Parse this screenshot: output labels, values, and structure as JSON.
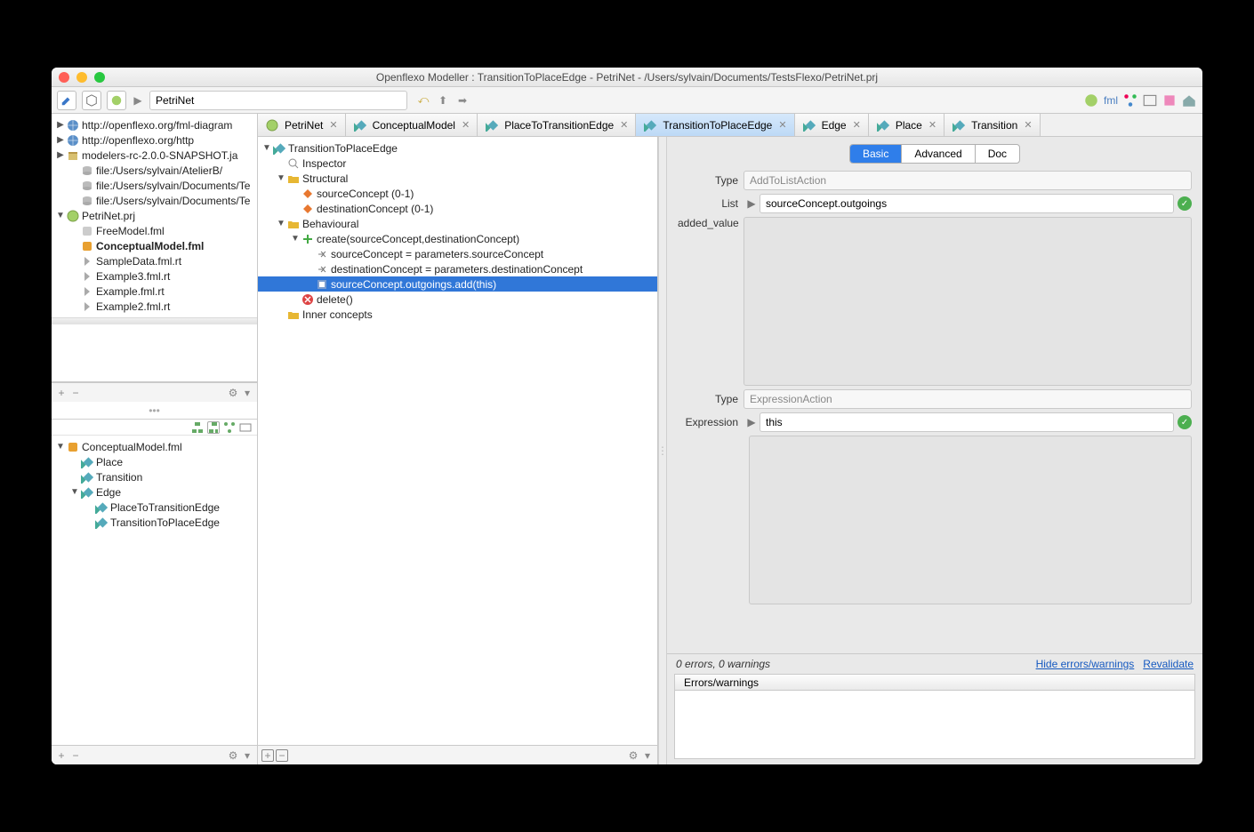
{
  "window": {
    "title": "Openflexo Modeller : TransitionToPlaceEdge - PetriNet - /Users/sylvain/Documents/TestsFlexo/PetriNet.prj"
  },
  "breadcrumb": {
    "current": "PetriNet"
  },
  "navTree": [
    {
      "indent": 0,
      "tog": "▶",
      "icon": "world",
      "label": "http://openflexo.org/fml-diagram",
      "bold": false
    },
    {
      "indent": 0,
      "tog": "▶",
      "icon": "world",
      "label": "http://openflexo.org/http",
      "bold": false
    },
    {
      "indent": 0,
      "tog": "▶",
      "icon": "archive",
      "label": "modelers-rc-2.0.0-SNAPSHOT.ja",
      "bold": false
    },
    {
      "indent": 1,
      "tog": "",
      "icon": "db",
      "label": "file:/Users/sylvain/AtelierB/",
      "bold": false
    },
    {
      "indent": 1,
      "tog": "",
      "icon": "db",
      "label": "file:/Users/sylvain/Documents/Te",
      "bold": false
    },
    {
      "indent": 1,
      "tog": "",
      "icon": "db",
      "label": "file:/Users/sylvain/Documents/Te",
      "bold": false
    },
    {
      "indent": 0,
      "tog": "▼",
      "icon": "proj",
      "label": "PetriNet.prj",
      "bold": false
    },
    {
      "indent": 1,
      "tog": "",
      "icon": "fml-g",
      "label": "FreeModel.fml",
      "bold": false
    },
    {
      "indent": 1,
      "tog": "",
      "icon": "fml",
      "label": "ConceptualModel.fml",
      "bold": true
    },
    {
      "indent": 1,
      "tog": "",
      "icon": "rt",
      "label": "SampleData.fml.rt",
      "bold": false
    },
    {
      "indent": 1,
      "tog": "",
      "icon": "rt",
      "label": "Example3.fml.rt",
      "bold": false
    },
    {
      "indent": 1,
      "tog": "",
      "icon": "rt",
      "label": "Example.fml.rt",
      "bold": false
    },
    {
      "indent": 1,
      "tog": "",
      "icon": "rt",
      "label": "Example2.fml.rt",
      "bold": false
    }
  ],
  "browserTree": [
    {
      "indent": 0,
      "tog": "▼",
      "icon": "fml",
      "label": "ConceptualModel.fml"
    },
    {
      "indent": 1,
      "tog": "",
      "icon": "cube",
      "label": "Place"
    },
    {
      "indent": 1,
      "tog": "",
      "icon": "cube",
      "label": "Transition"
    },
    {
      "indent": 1,
      "tog": "▼",
      "icon": "cube",
      "label": "Edge"
    },
    {
      "indent": 2,
      "tog": "",
      "icon": "cube",
      "label": "PlaceToTransitionEdge"
    },
    {
      "indent": 2,
      "tog": "",
      "icon": "cube",
      "label": "TransitionToPlaceEdge"
    }
  ],
  "tabs": [
    {
      "label": "PetriNet",
      "icon": "proj",
      "active": false
    },
    {
      "label": "ConceptualModel",
      "icon": "cube",
      "active": false
    },
    {
      "label": "PlaceToTransitionEdge",
      "icon": "cube",
      "active": false
    },
    {
      "label": "TransitionToPlaceEdge",
      "icon": "cube",
      "active": true
    },
    {
      "label": "Edge",
      "icon": "cube",
      "active": false
    },
    {
      "label": "Place",
      "icon": "cube",
      "active": false
    },
    {
      "label": "Transition",
      "icon": "cube",
      "active": false
    }
  ],
  "centerTree": [
    {
      "indent": 0,
      "tog": "▼",
      "icon": "cube",
      "label": "TransitionToPlaceEdge",
      "sel": false
    },
    {
      "indent": 1,
      "tog": "",
      "icon": "mag",
      "label": "Inspector",
      "sel": false
    },
    {
      "indent": 1,
      "tog": "▼",
      "icon": "folder",
      "label": "Structural",
      "sel": false
    },
    {
      "indent": 2,
      "tog": "",
      "icon": "orange",
      "label": "sourceConcept (0-1)",
      "sel": false
    },
    {
      "indent": 2,
      "tog": "",
      "icon": "orange",
      "label": "destinationConcept (0-1)",
      "sel": false
    },
    {
      "indent": 1,
      "tog": "▼",
      "icon": "folder",
      "label": "Behavioural",
      "sel": false
    },
    {
      "indent": 2,
      "tog": "▼",
      "icon": "plus",
      "label": "create(sourceConcept,destinationConcept)",
      "sel": false
    },
    {
      "indent": 3,
      "tog": "",
      "icon": "assign",
      "label": "sourceConcept = parameters.sourceConcept",
      "sel": false
    },
    {
      "indent": 3,
      "tog": "",
      "icon": "assign",
      "label": "destinationConcept = parameters.destinationConcept",
      "sel": false
    },
    {
      "indent": 3,
      "tog": "",
      "icon": "action",
      "label": "sourceConcept.outgoings.add(this)",
      "sel": true
    },
    {
      "indent": 2,
      "tog": "",
      "icon": "delete",
      "label": "delete()",
      "sel": false
    },
    {
      "indent": 1,
      "tog": "",
      "icon": "folder",
      "label": "Inner concepts",
      "sel": false
    }
  ],
  "propsTabs": {
    "items": [
      "Basic",
      "Advanced",
      "Doc"
    ],
    "active": "Basic"
  },
  "form": {
    "type1_label": "Type",
    "type1_value": "AddToListAction",
    "list_label": "List",
    "list_value": "sourceConcept.outgoings",
    "added_label": "added_value",
    "type2_label": "Type",
    "type2_value": "ExpressionAction",
    "expr_label": "Expression",
    "expr_value": "this"
  },
  "errors": {
    "summary": "0 errors, 0 warnings",
    "hide": "Hide errors/warnings",
    "revalidate": "Revalidate",
    "col": "Errors/warnings"
  }
}
